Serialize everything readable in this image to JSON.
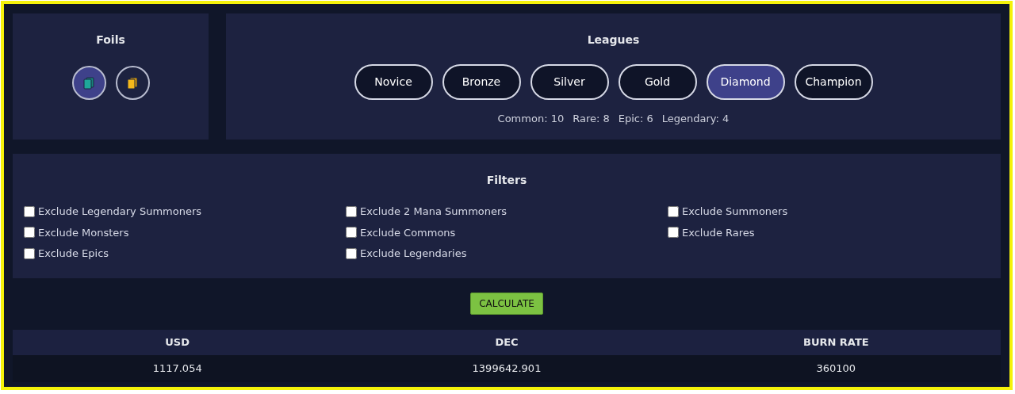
{
  "foils": {
    "title": "Foils",
    "options": [
      {
        "kind": "regular",
        "selected": true
      },
      {
        "kind": "gold",
        "selected": false
      }
    ]
  },
  "leagues": {
    "title": "Leagues",
    "items": [
      {
        "label": "Novice",
        "selected": false
      },
      {
        "label": "Bronze",
        "selected": false
      },
      {
        "label": "Silver",
        "selected": false
      },
      {
        "label": "Gold",
        "selected": false
      },
      {
        "label": "Diamond",
        "selected": true
      },
      {
        "label": "Champion",
        "selected": false
      }
    ],
    "counts": [
      "Common: 10",
      "Rare: 8",
      "Epic: 6",
      "Legendary: 4"
    ]
  },
  "filters": {
    "title": "Filters",
    "columns": [
      [
        {
          "label": "Exclude Legendary Summoners",
          "checked": false
        },
        {
          "label": "Exclude Monsters",
          "checked": false
        },
        {
          "label": "Exclude Epics",
          "checked": false
        }
      ],
      [
        {
          "label": "Exclude 2 Mana Summoners",
          "checked": false
        },
        {
          "label": "Exclude Commons",
          "checked": false
        },
        {
          "label": "Exclude Legendaries",
          "checked": false
        }
      ],
      [
        {
          "label": "Exclude Summoners",
          "checked": false
        },
        {
          "label": "Exclude Rares",
          "checked": false
        }
      ]
    ]
  },
  "calculate_button": "CALCULATE",
  "results": {
    "columns": [
      "USD",
      "DEC",
      "BURN RATE"
    ],
    "row": [
      "1117.054",
      "1399642.901",
      "360100"
    ]
  }
}
